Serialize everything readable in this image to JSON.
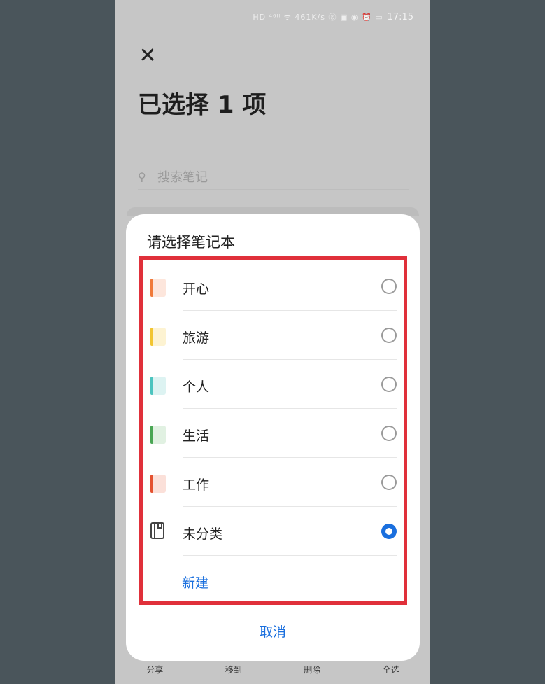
{
  "status_bar": {
    "icons": "HD ⁴⁶ᴵˡ ᯤ 461K/s  ⓖ ▣ ◉ ⏰ ▭",
    "time": "17:15"
  },
  "header": {
    "title": "已选择 1 项"
  },
  "search": {
    "placeholder": "搜索笔记"
  },
  "dialog": {
    "title": "请选择笔记本",
    "notebooks": [
      {
        "label": "开心",
        "spine": "#f07a3a",
        "fill": "#fde6dc",
        "selected": false
      },
      {
        "label": "旅游",
        "spine": "#f2c531",
        "fill": "#fdf3d2",
        "selected": false
      },
      {
        "label": "个人",
        "spine": "#4cc4bf",
        "fill": "#ddf3f2",
        "selected": false
      },
      {
        "label": "生活",
        "spine": "#4aa654",
        "fill": "#e1f1e2",
        "selected": false
      },
      {
        "label": "工作",
        "spine": "#e4512f",
        "fill": "#fbe0d9",
        "selected": false
      }
    ],
    "uncategorized": {
      "label": "未分类",
      "selected": true
    },
    "new_label": "新建",
    "cancel_label": "取消"
  },
  "bottom_bar": {
    "share": "分享",
    "move": "移到",
    "delete": "删除",
    "select_all": "全选"
  },
  "colors": {
    "accent": "#1a6fde",
    "highlight_box": "#e0303a"
  }
}
